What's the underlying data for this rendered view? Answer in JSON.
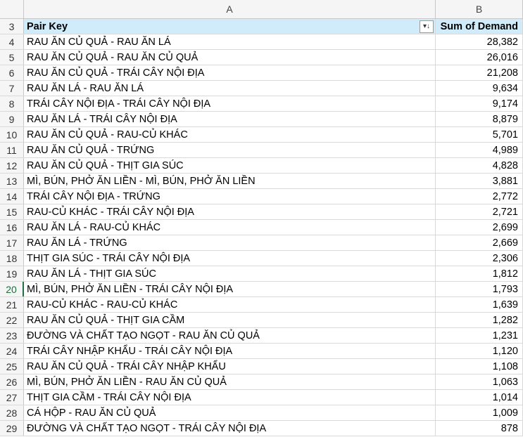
{
  "columns": {
    "a": "A",
    "b": "B"
  },
  "header": {
    "row_number": "3",
    "pair_key": "Pair Key",
    "sum_label": "Sum of Demand",
    "filter_icon": "sort-descending-filter-icon"
  },
  "rows": [
    {
      "n": "4",
      "key": "RAU ĂN CỦ QUẢ - RAU ĂN LÁ",
      "val": "28,382"
    },
    {
      "n": "5",
      "key": "RAU ĂN CỦ QUẢ - RAU ĂN CỦ QUẢ",
      "val": "26,016"
    },
    {
      "n": "6",
      "key": "RAU ĂN CỦ QUẢ - TRÁI CÂY NỘI ĐỊA",
      "val": "21,208"
    },
    {
      "n": "7",
      "key": "RAU ĂN LÁ - RAU ĂN LÁ",
      "val": "9,634"
    },
    {
      "n": "8",
      "key": "TRÁI CÂY NỘI ĐỊA - TRÁI CÂY NỘI ĐỊA",
      "val": "9,174"
    },
    {
      "n": "9",
      "key": "RAU ĂN LÁ - TRÁI CÂY NỘI ĐỊA",
      "val": "8,879"
    },
    {
      "n": "10",
      "key": "RAU ĂN CỦ QUẢ - RAU-CỦ KHÁC",
      "val": "5,701"
    },
    {
      "n": "11",
      "key": "RAU ĂN CỦ QUẢ - TRỨNG",
      "val": "4,989"
    },
    {
      "n": "12",
      "key": "RAU ĂN CỦ QUẢ - THỊT GIA SÚC",
      "val": "4,828"
    },
    {
      "n": "13",
      "key": "MÌ, BÚN, PHỞ ĂN LIỀN - MÌ, BÚN, PHỞ ĂN LIỀN",
      "val": "3,881"
    },
    {
      "n": "14",
      "key": "TRÁI CÂY NỘI ĐỊA - TRỨNG",
      "val": "2,772"
    },
    {
      "n": "15",
      "key": "RAU-CỦ KHÁC - TRÁI CÂY NỘI ĐỊA",
      "val": "2,721"
    },
    {
      "n": "16",
      "key": "RAU ĂN LÁ - RAU-CỦ KHÁC",
      "val": "2,699"
    },
    {
      "n": "17",
      "key": "RAU ĂN LÁ - TRỨNG",
      "val": "2,669"
    },
    {
      "n": "18",
      "key": "THỊT GIA SÚC - TRÁI CÂY NỘI ĐỊA",
      "val": "2,306"
    },
    {
      "n": "19",
      "key": "RAU ĂN LÁ - THỊT GIA SÚC",
      "val": "1,812"
    },
    {
      "n": "20",
      "key": "MÌ, BÚN, PHỞ ĂN LIỀN - TRÁI CÂY NỘI ĐỊA",
      "val": "1,793"
    },
    {
      "n": "21",
      "key": "RAU-CỦ KHÁC - RAU-CỦ KHÁC",
      "val": "1,639"
    },
    {
      "n": "22",
      "key": "RAU ĂN CỦ QUẢ - THỊT GIA CẦM",
      "val": "1,282"
    },
    {
      "n": "23",
      "key": "ĐƯỜNG VÀ CHẤT TẠO NGỌT - RAU ĂN CỦ QUẢ",
      "val": "1,231"
    },
    {
      "n": "24",
      "key": "TRÁI CÂY NHẬP KHẨU - TRÁI CÂY NỘI ĐỊA",
      "val": "1,120"
    },
    {
      "n": "25",
      "key": "RAU ĂN CỦ QUẢ - TRÁI CÂY NHẬP KHẨU",
      "val": "1,108"
    },
    {
      "n": "26",
      "key": "MÌ, BÚN, PHỞ ĂN LIỀN - RAU ĂN CỦ QUẢ",
      "val": "1,063"
    },
    {
      "n": "27",
      "key": "THỊT GIA CẦM - TRÁI CÂY NỘI ĐỊA",
      "val": "1,014"
    },
    {
      "n": "28",
      "key": "CÁ HỘP - RAU ĂN CỦ QUẢ",
      "val": "1,009"
    },
    {
      "n": "29",
      "key": "ĐƯỜNG VÀ CHẤT TẠO NGỌT - TRÁI CÂY NỘI ĐỊA",
      "val": "878"
    }
  ],
  "active_row": "20",
  "colors": {
    "header_fill": "#d0ebf9",
    "grid": "#d9d9d9",
    "active_row_accent": "#1e7145"
  }
}
